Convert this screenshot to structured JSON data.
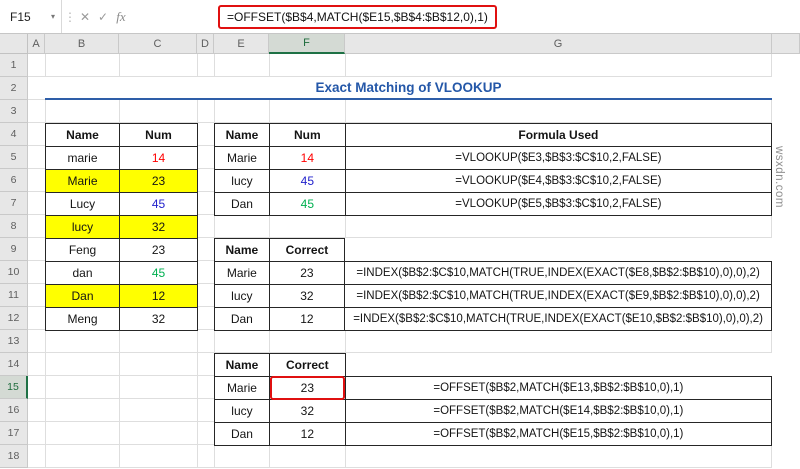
{
  "formula_bar": {
    "cell_ref": "F15",
    "formula": "=OFFSET($B$4,MATCH($E15,$B$4:$B$12,0),1)"
  },
  "icons": {
    "dropdown": "▾",
    "separator": "⋮",
    "cancel": "✕",
    "enter": "✓",
    "fx": "fx"
  },
  "colors": {
    "annotation_red": "#e01010",
    "title_blue": "#2457a8",
    "highlight_yellow": "#ffff00",
    "num_red": "#ff0000",
    "num_blue": "#2222cc",
    "num_green": "#00b050"
  },
  "grid": {
    "columns": [
      "A",
      "B",
      "C",
      "D",
      "E",
      "F",
      "G"
    ],
    "rows": [
      "1",
      "2",
      "3",
      "4",
      "5",
      "6",
      "7",
      "8",
      "9",
      "10",
      "11",
      "12",
      "13",
      "14",
      "15",
      "16",
      "17",
      "18"
    ],
    "selected_column": "F",
    "selected_row": "15"
  },
  "title": "Exact Matching of VLOOKUP",
  "source_table": {
    "headers": [
      "Name",
      "Num"
    ],
    "rows": [
      {
        "name": "marie",
        "num": "14",
        "color": "#ff0000",
        "bg": ""
      },
      {
        "name": "Marie",
        "num": "23",
        "color": "#141414",
        "bg": "#ffff00"
      },
      {
        "name": "Lucy",
        "num": "45",
        "color": "#2222cc",
        "bg": ""
      },
      {
        "name": "lucy",
        "num": "32",
        "color": "#141414",
        "bg": "#ffff00"
      },
      {
        "name": "Feng",
        "num": "23",
        "color": "#141414",
        "bg": ""
      },
      {
        "name": "dan",
        "num": "45",
        "color": "#00b050",
        "bg": ""
      },
      {
        "name": "Dan",
        "num": "12",
        "color": "#141414",
        "bg": "#ffff00"
      },
      {
        "name": "Meng",
        "num": "32",
        "color": "#141414",
        "bg": ""
      }
    ]
  },
  "vlookup_table": {
    "headers": [
      "Name",
      "Num",
      "Formula Used"
    ],
    "rows": [
      {
        "name": "Marie",
        "num": "14",
        "color": "#ff0000",
        "formula": "=VLOOKUP($E3,$B$3:$C$10,2,FALSE)"
      },
      {
        "name": "lucy",
        "num": "45",
        "color": "#2222cc",
        "formula": "=VLOOKUP($E4,$B$3:$C$10,2,FALSE)"
      },
      {
        "name": "Dan",
        "num": "45",
        "color": "#00b050",
        "formula": "=VLOOKUP($E5,$B$3:$C$10,2,FALSE)"
      }
    ]
  },
  "index_table": {
    "headers": [
      "Name",
      "Correct"
    ],
    "rows": [
      {
        "name": "Marie",
        "num": "23",
        "formula": "=INDEX($B$2:$C$10,MATCH(TRUE,INDEX(EXACT($E8,$B$2:$B$10),0),0),2)"
      },
      {
        "name": "lucy",
        "num": "32",
        "formula": "=INDEX($B$2:$C$10,MATCH(TRUE,INDEX(EXACT($E9,$B$2:$B$10),0),0),2)"
      },
      {
        "name": "Dan",
        "num": "12",
        "formula": "=INDEX($B$2:$C$10,MATCH(TRUE,INDEX(EXACT($E10,$B$2:$B$10),0),0),2)"
      }
    ]
  },
  "offset_table": {
    "headers": [
      "Name",
      "Correct"
    ],
    "rows": [
      {
        "name": "Marie",
        "num": "23",
        "formula": "=OFFSET($B$2,MATCH($E13,$B$2:$B$10,0),1)"
      },
      {
        "name": "lucy",
        "num": "32",
        "formula": "=OFFSET($B$2,MATCH($E14,$B$2:$B$10,0),1)"
      },
      {
        "name": "Dan",
        "num": "12",
        "formula": "=OFFSET($B$2,MATCH($E15,$B$2:$B$10,0),1)"
      }
    ]
  },
  "watermark": "wsxdn.com"
}
